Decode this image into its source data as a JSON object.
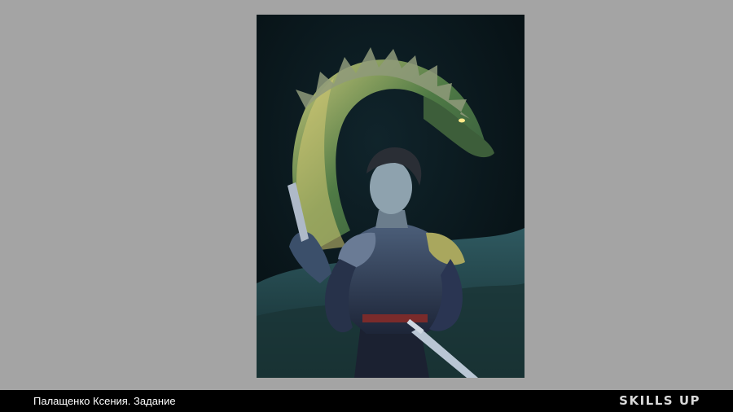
{
  "slide": {
    "background_color": "#a4a4a4",
    "artwork_subject": "painting of a young person in dark plate armor with a green dragon coiled behind"
  },
  "footer": {
    "caption": "Палащенко Ксения. Задание",
    "brand": "SKILLS UP",
    "background_color": "#000000"
  }
}
